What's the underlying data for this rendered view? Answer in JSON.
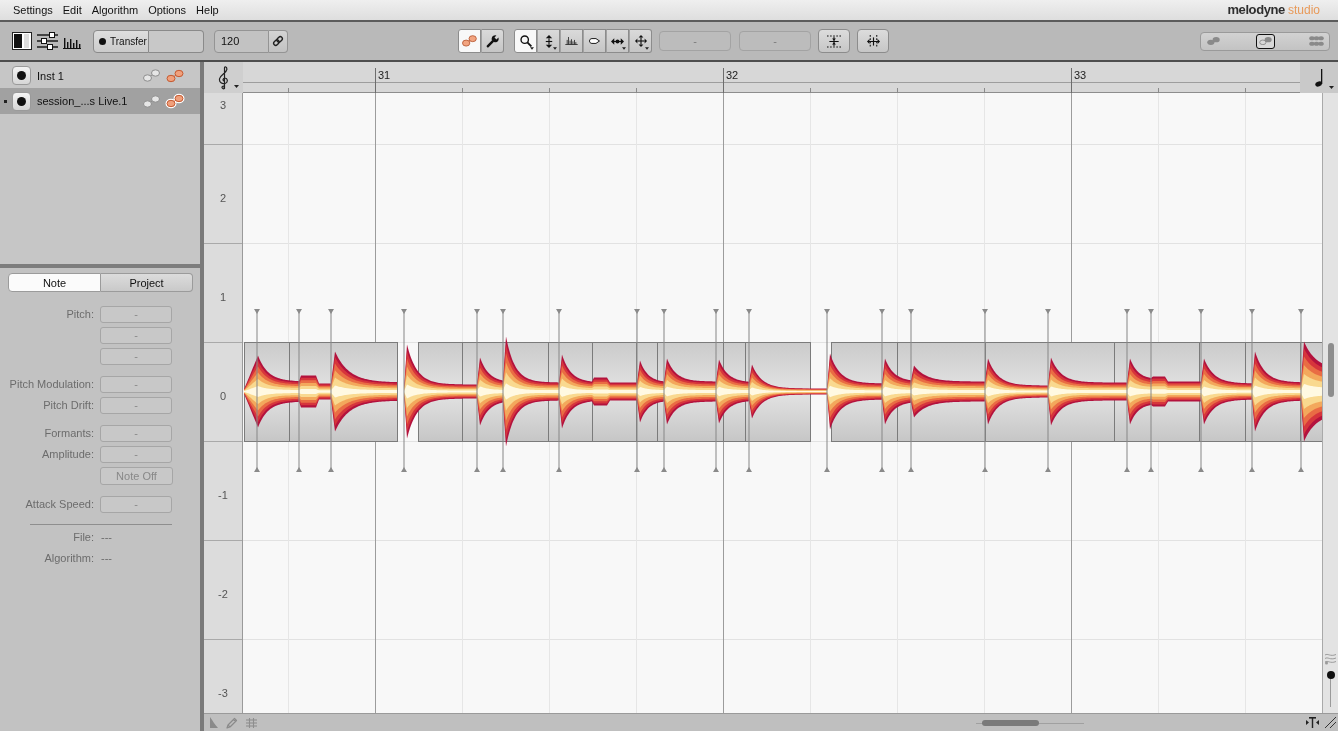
{
  "menu_bar": {
    "items": [
      "Settings",
      "Edit",
      "Algorithm",
      "Options",
      "Help"
    ],
    "logo": {
      "brand": "melodyne",
      "edition": "studio"
    }
  },
  "toolbar": {
    "view_buttons": [
      {
        "kind": "panel"
      },
      {
        "kind": "mixer"
      },
      {
        "kind": "bars"
      }
    ],
    "transfer": {
      "label": "Transfer"
    },
    "tempo": {
      "value": "120"
    },
    "modes": [
      {
        "kind": "blobs",
        "selected": true
      },
      {
        "kind": "wrench",
        "selected": false
      }
    ],
    "tools": [
      {
        "kind": "zoom",
        "selected": true,
        "has_menu": true
      },
      {
        "kind": "pitch",
        "selected": false,
        "has_menu": true
      },
      {
        "kind": "amplitude",
        "selected": false,
        "has_menu": false
      },
      {
        "kind": "formant",
        "selected": false,
        "has_menu": false
      },
      {
        "kind": "time",
        "selected": false,
        "has_menu": true
      },
      {
        "kind": "move",
        "selected": false,
        "has_menu": true
      }
    ],
    "readouts": [
      "-",
      "-"
    ],
    "actions": [
      {
        "kind": "pitch_quantize"
      },
      {
        "kind": "time_quantize"
      }
    ],
    "view_slider": [
      {
        "kind": "single",
        "selected": false
      },
      {
        "kind": "pair",
        "selected": true
      },
      {
        "kind": "many",
        "selected": false
      }
    ]
  },
  "tracks": [
    {
      "name": "Inst 1",
      "selected": false
    },
    {
      "name": "session_...s Live.1",
      "selected": true
    }
  ],
  "inspector": {
    "tabs": [
      {
        "label": "Note",
        "selected": true
      },
      {
        "label": "Project",
        "selected": false
      }
    ],
    "groups": [
      [
        {
          "kind": "field",
          "label": "Pitch:",
          "values": [
            "-",
            "-",
            "-"
          ]
        }
      ],
      [
        {
          "kind": "field",
          "label": "Pitch Modulation:",
          "values": [
            "-"
          ]
        },
        {
          "kind": "field",
          "label": "Pitch Drift:",
          "values": [
            "-"
          ]
        }
      ],
      [
        {
          "kind": "field",
          "label": "Formants:",
          "values": [
            "-"
          ]
        },
        {
          "kind": "field",
          "label": "Amplitude:",
          "values": [
            "-"
          ]
        },
        {
          "kind": "button",
          "label": "Note Off"
        }
      ],
      [
        {
          "kind": "field",
          "label": "Attack Speed:",
          "values": [
            "-"
          ]
        }
      ]
    ],
    "info": [
      {
        "label": "File:",
        "text": "---"
      },
      {
        "label": "Algorithm:",
        "text": "---"
      }
    ]
  },
  "editor": {
    "bars": [
      "31",
      "32",
      "33"
    ],
    "pitch_labels": [
      "3",
      "2",
      "1",
      "0",
      "-1",
      "-2",
      "-3"
    ],
    "vertical_zoom": {
      "level": 1
    }
  }
}
